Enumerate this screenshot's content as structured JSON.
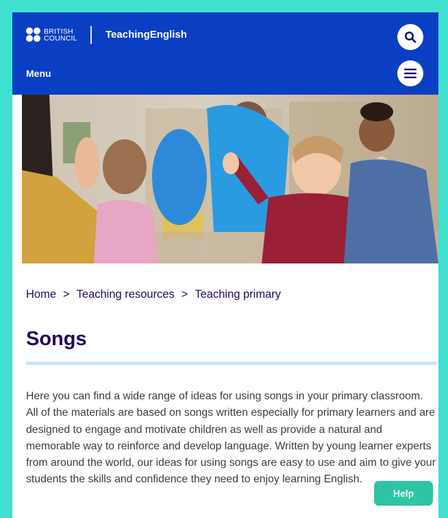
{
  "header": {
    "logo_line1": "BRITISH",
    "logo_line2": "COUNCIL",
    "site_name": "TeachingEnglish",
    "menu_label": "Menu",
    "search_icon": "search-icon",
    "menu_icon": "hamburger-menu-icon"
  },
  "hero": {
    "image": "children-clapping-classroom-photo"
  },
  "breadcrumb": {
    "items": [
      "Home",
      "Teaching resources",
      "Teaching primary"
    ],
    "separator": ">"
  },
  "page": {
    "title": "Songs",
    "intro": "Here you can find a wide range of ideas for using songs in your primary classroom. All of the materials are based on songs written especially for primary learners and are designed to engage and motivate children as well as provide a natural and memorable way to reinforce and develop language. Written by young learner experts from around the world, our ideas for using songs are easy to use and aim to give your students the skills and confidence they need to enjoy learning English."
  },
  "help": {
    "label": "Help"
  },
  "colors": {
    "header_bg": "#0a3fc4",
    "page_border": "#3fe0cf",
    "title": "#23085a",
    "rule": "#c8e6fa",
    "help_button": "#2ec4a4"
  }
}
